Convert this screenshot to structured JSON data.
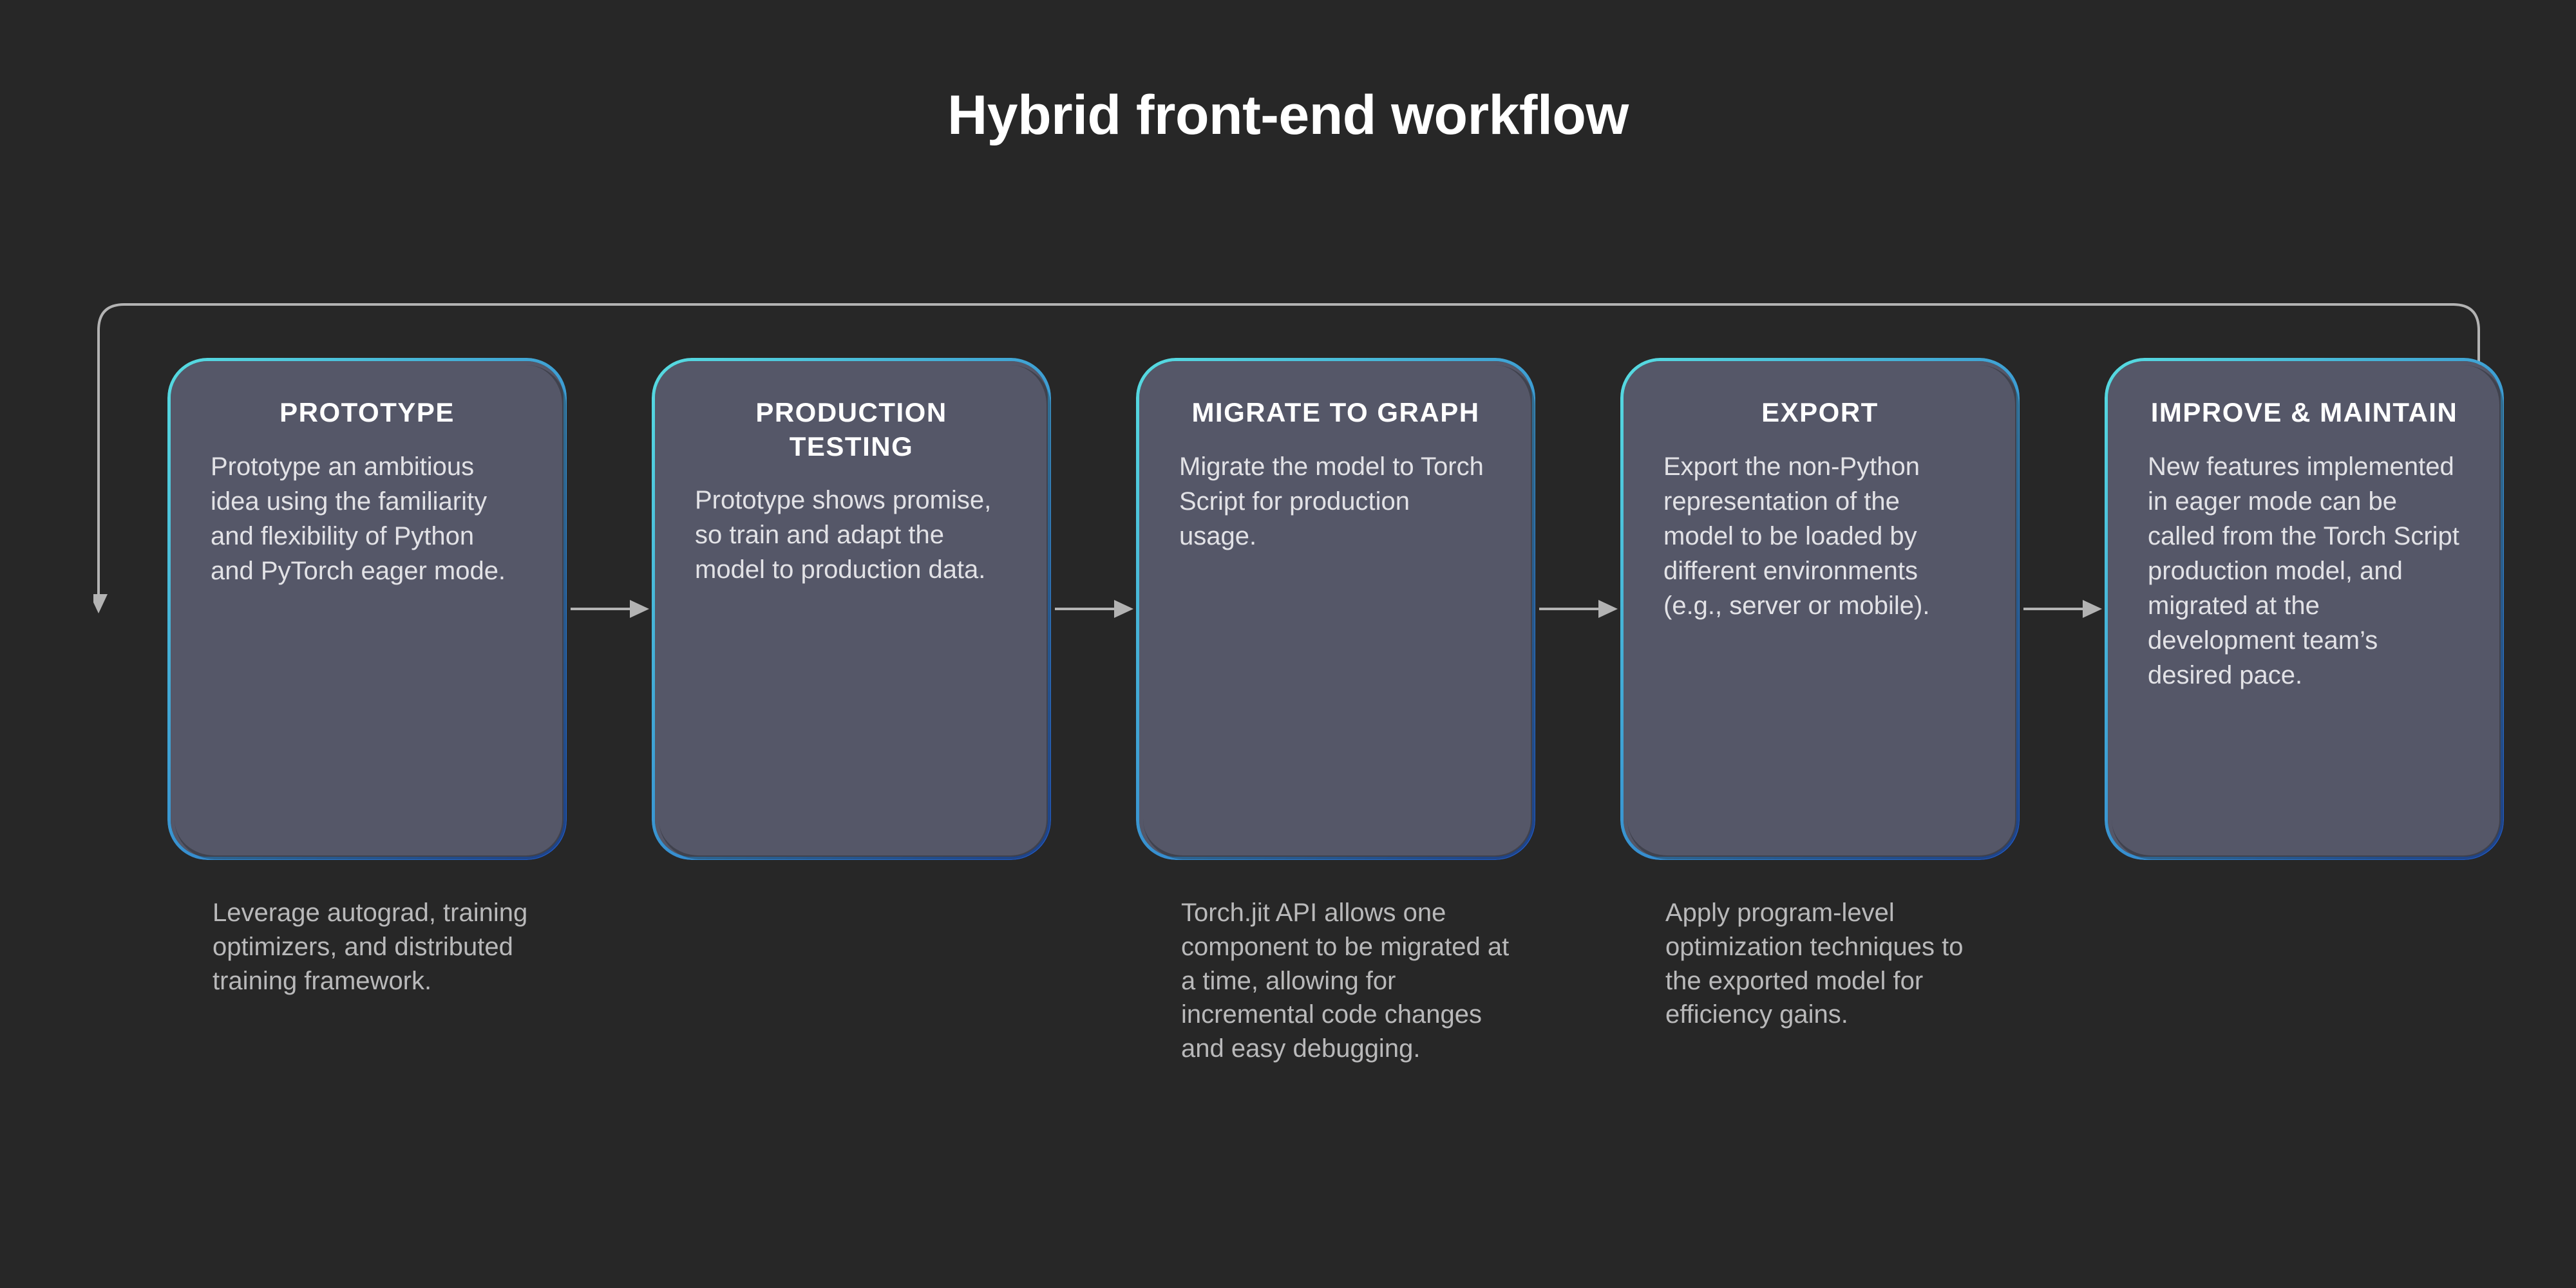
{
  "title": "Hybrid front-end workflow",
  "stages": [
    {
      "heading": "PROTOTYPE",
      "body": "Prototype an ambitious idea using the familiarity and flexibility of Python and PyTorch eager mode.",
      "footnote": "Leverage autograd, training optimizers, and distributed training framework."
    },
    {
      "heading": "PRODUCTION TESTING",
      "body": "Prototype shows promise, so train and adapt the model to production data.",
      "footnote": ""
    },
    {
      "heading": "MIGRATE TO GRAPH",
      "body": "Migrate the model to Torch Script for production usage.",
      "footnote": "Torch.jit API allows one component to be migrated at a time, allowing for incremental code changes and easy debugging."
    },
    {
      "heading": "EXPORT",
      "body": "Export the non-Python representation of the model to be loaded by different environments (e.g., server or mobile).",
      "footnote": "Apply program-level optimization techniques to the exported model for efficiency gains."
    },
    {
      "heading": "IMPROVE & MAINTAIN",
      "body": "New features implemented in eager mode can be called from the Torch Script production model, and migrated at the development team’s desired pace.",
      "footnote": ""
    }
  ],
  "colors": {
    "background": "#272727",
    "box_fill": "#555768",
    "gradient_start": "#57dce1",
    "gradient_end": "#1f56c3",
    "title_text": "#ffffff",
    "body_text": "#e2e2e6",
    "footnote_text": "#b9b9ba",
    "arrow": "#b3b3b3"
  }
}
